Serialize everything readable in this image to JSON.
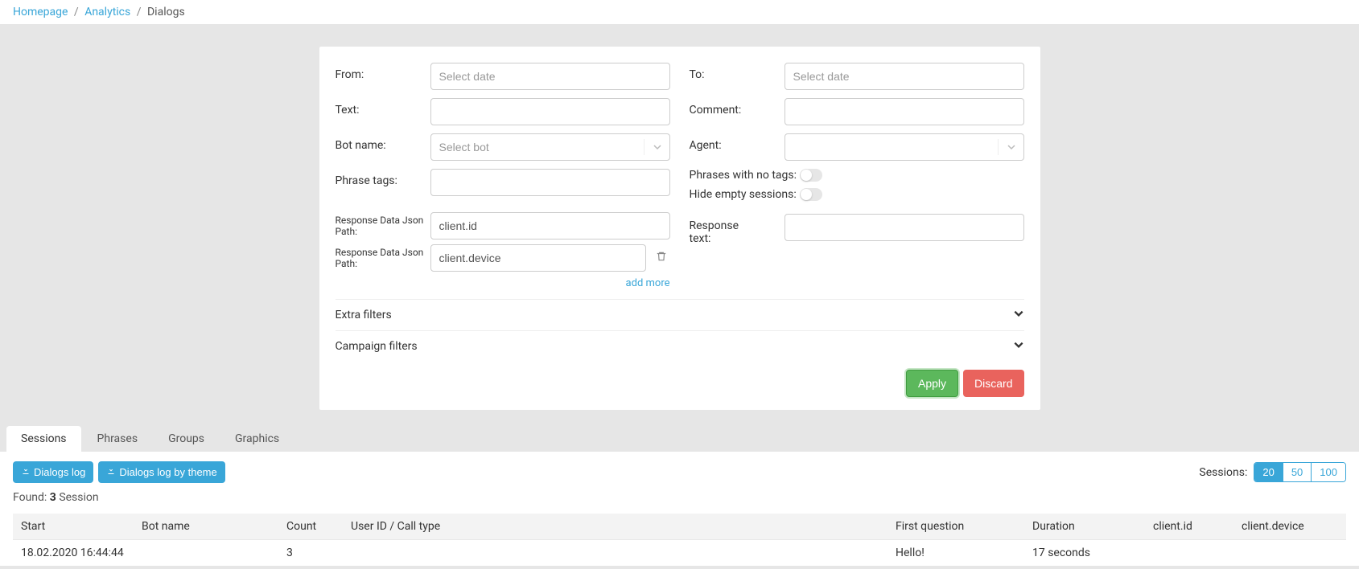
{
  "breadcrumb": {
    "items": [
      {
        "label": "Homepage",
        "link": true
      },
      {
        "label": "Analytics",
        "link": true
      },
      {
        "label": "Dialogs",
        "link": false
      }
    ]
  },
  "filters": {
    "from_label": "From:",
    "from_placeholder": "Select date",
    "to_label": "To:",
    "to_placeholder": "Select date",
    "text_label": "Text:",
    "comment_label": "Comment:",
    "botname_label": "Bot name:",
    "botname_placeholder": "Select bot",
    "agent_label": "Agent:",
    "phrase_tags_label": "Phrase tags:",
    "phrases_no_tags_label": "Phrases with no tags:",
    "hide_empty_label": "Hide empty sessions:",
    "response_json_label": "Response Data Json Path:",
    "response_text_label": "Response text:",
    "json_paths": [
      {
        "value": "client.id"
      },
      {
        "value": "client.device"
      }
    ],
    "add_more_label": "add more",
    "extra_filters_label": "Extra filters",
    "campaign_filters_label": "Campaign filters",
    "apply_label": "Apply",
    "discard_label": "Discard"
  },
  "tabs": {
    "items": [
      {
        "label": "Sessions",
        "active": true
      },
      {
        "label": "Phrases",
        "active": false
      },
      {
        "label": "Groups",
        "active": false
      },
      {
        "label": "Graphics",
        "active": false
      }
    ]
  },
  "results": {
    "dialogs_log_btn": "Dialogs log",
    "dialogs_log_theme_btn": "Dialogs log by theme",
    "sessions_label": "Sessions:",
    "page_sizes": [
      "20",
      "50",
      "100"
    ],
    "page_size_active": "20",
    "found_prefix": "Found: ",
    "found_count": "3",
    "found_suffix": " Session",
    "columns": [
      "Start",
      "Bot name",
      "Count",
      "User ID / Call type",
      "First question",
      "Duration",
      "client.id",
      "client.device"
    ],
    "rows": [
      {
        "start": "18.02.2020 16:44:44",
        "bot_name": "",
        "count": "3",
        "user_id": "",
        "first_question": "Hello!",
        "duration": "17 seconds",
        "client_id": "",
        "client_device": ""
      }
    ]
  }
}
